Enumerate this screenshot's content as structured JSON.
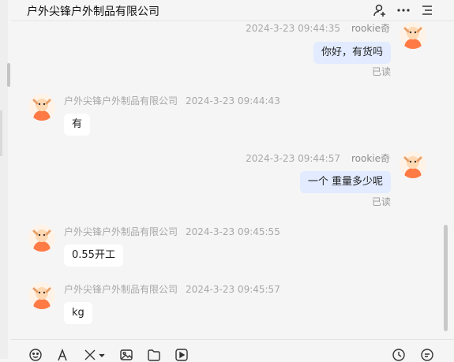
{
  "chat": {
    "title": "户外尖锋户外制品有限公司",
    "messages": [
      {
        "side": "self",
        "name": "rookie奇",
        "time": "2024-3-23 09:44:35",
        "text": "你好，有货吗",
        "read": "已读"
      },
      {
        "side": "other",
        "name": "户外尖锋户外制品有限公司",
        "time": "2024-3-23 09:44:43",
        "text": "有"
      },
      {
        "side": "self",
        "name": "rookie奇",
        "time": "2024-3-23 09:44:57",
        "text": "一个 重量多少呢",
        "read": "已读"
      },
      {
        "side": "other",
        "name": "户外尖锋户外制品有限公司",
        "time": "2024-3-23 09:45:55",
        "text": "0.55开工"
      },
      {
        "side": "other",
        "name": "户外尖锋户外制品有限公司",
        "time": "2024-3-23 09:45:57",
        "text": "kg"
      }
    ]
  },
  "header_icons": [
    "add-user-icon",
    "more-icon",
    "menu-icon"
  ],
  "toolbar_icons": [
    "emoji-icon",
    "font-icon",
    "scissors-icon",
    "image-icon",
    "folder-icon",
    "video-icon",
    "clock-icon",
    "quick-reply-icon"
  ],
  "colors": {
    "self_bubble": "#e2ebff",
    "other_bubble": "#ffffff",
    "background": "#f5f5f6",
    "avatar_orange": "#ff7a45"
  }
}
